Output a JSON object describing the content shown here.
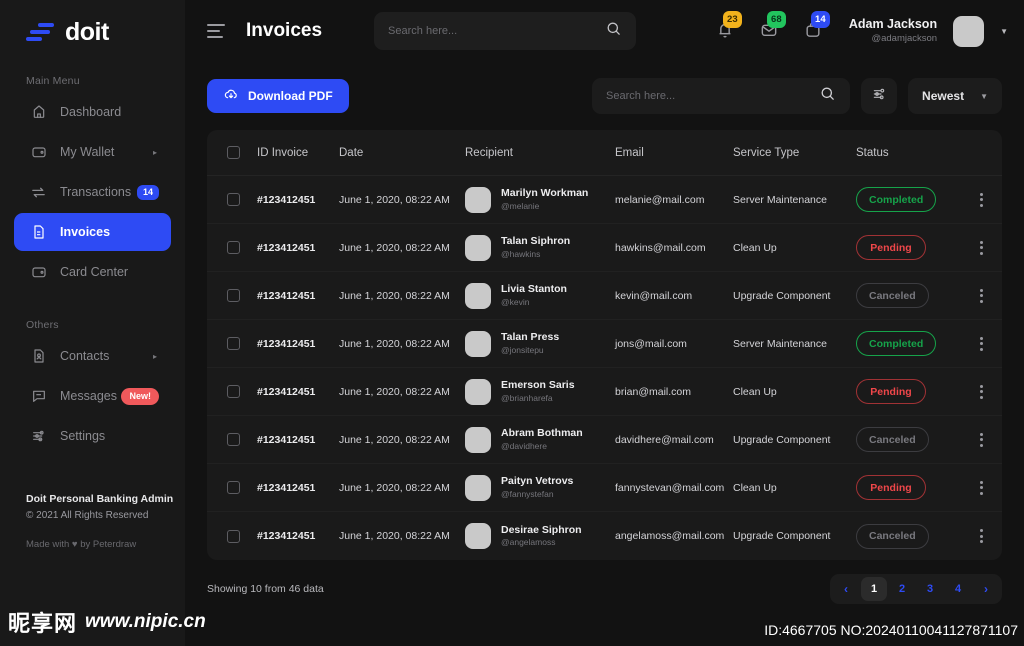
{
  "brand": {
    "name": "doit",
    "accent": "#2E4BF4"
  },
  "sidebar": {
    "main_label": "Main Menu",
    "others_label": "Others",
    "main_items": [
      {
        "label": "Dashboard",
        "icon": "home-icon"
      },
      {
        "label": "My Wallet",
        "icon": "wallet-icon",
        "arrow": "▸"
      },
      {
        "label": "Transactions",
        "icon": "transfer-icon",
        "badge": "14"
      },
      {
        "label": "Invoices",
        "icon": "invoice-icon",
        "active": true
      },
      {
        "label": "Card Center",
        "icon": "card-icon"
      }
    ],
    "other_items": [
      {
        "label": "Contacts",
        "icon": "contacts-icon",
        "arrow": "▸"
      },
      {
        "label": "Messages",
        "icon": "message-icon",
        "badge": "New!"
      },
      {
        "label": "Settings",
        "icon": "settings-icon"
      }
    ],
    "footer": {
      "title": "Doit Personal Banking Admin",
      "copyright": "© 2021 All Rights Reserved",
      "made_by": "Made with ♥ by Peterdraw"
    }
  },
  "header": {
    "title": "Invoices",
    "search_placeholder": "Search here...",
    "search_value": "",
    "notifications": [
      {
        "icon": "bell-icon",
        "count": "23",
        "color": "#F2B21C"
      },
      {
        "icon": "mail-icon",
        "count": "68",
        "color": "#22C55E"
      },
      {
        "icon": "bag-icon",
        "count": "14",
        "color": "#2E4BF4"
      }
    ],
    "user": {
      "name": "Adam Jackson",
      "handle": "@adamjackson"
    }
  },
  "toolbar": {
    "download_label": "Download PDF",
    "download_icon": "cloud-download-icon",
    "search_placeholder": "Search here...",
    "search_value": "",
    "filter_icon": "filter-sliders-icon",
    "sort_label": "Newest"
  },
  "table": {
    "columns": [
      "ID Invoice",
      "Date",
      "Recipient",
      "Email",
      "Service Type",
      "Status"
    ],
    "rows": [
      {
        "id": "#123412451",
        "date": "June 1, 2020, 08:22 AM",
        "name": "Marilyn Workman",
        "handle": "@melanie",
        "email": "melanie@mail.com",
        "service": "Server Maintenance",
        "status": "Completed",
        "status_kind": "completed"
      },
      {
        "id": "#123412451",
        "date": "June 1, 2020, 08:22 AM",
        "name": "Talan Siphron",
        "handle": "@hawkins",
        "email": "hawkins@mail.com",
        "service": "Clean Up",
        "status": "Pending",
        "status_kind": "pending"
      },
      {
        "id": "#123412451",
        "date": "June 1, 2020, 08:22 AM",
        "name": "Livia Stanton",
        "handle": "@kevin",
        "email": "kevin@mail.com",
        "service": "Upgrade Component",
        "status": "Canceled",
        "status_kind": "canceled"
      },
      {
        "id": "#123412451",
        "date": "June 1, 2020, 08:22 AM",
        "name": "Talan Press",
        "handle": "@jonsitepu",
        "email": "jons@mail.com",
        "service": "Server Maintenance",
        "status": "Completed",
        "status_kind": "completed"
      },
      {
        "id": "#123412451",
        "date": "June 1, 2020, 08:22 AM",
        "name": "Emerson Saris",
        "handle": "@brianharefa",
        "email": "brian@mail.com",
        "service": "Clean Up",
        "status": "Pending",
        "status_kind": "pending"
      },
      {
        "id": "#123412451",
        "date": "June 1, 2020, 08:22 AM",
        "name": "Abram Bothman",
        "handle": "@davidhere",
        "email": "davidhere@mail.com",
        "service": "Upgrade Component",
        "status": "Canceled",
        "status_kind": "canceled"
      },
      {
        "id": "#123412451",
        "date": "June 1, 2020, 08:22 AM",
        "name": "Paityn Vetrovs",
        "handle": "@fannystefan",
        "email": "fannystevan@mail.com",
        "service": "Clean Up",
        "status": "Pending",
        "status_kind": "pending"
      },
      {
        "id": "#123412451",
        "date": "June 1, 2020, 08:22 AM",
        "name": "Desirae Siphron",
        "handle": "@angelamoss",
        "email": "angelamoss@mail.com",
        "service": "Upgrade Component",
        "status": "Canceled",
        "status_kind": "canceled"
      }
    ]
  },
  "footer": {
    "showing": "Showing 10 from 46 data",
    "pages": [
      "1",
      "2",
      "3",
      "4"
    ],
    "active_page": "1",
    "prev": "‹",
    "next": "›"
  },
  "watermark": {
    "cn": "昵享网",
    "url": "www.nipic.cn",
    "id_line": "ID:4667705 NO:20240110041127871107"
  }
}
